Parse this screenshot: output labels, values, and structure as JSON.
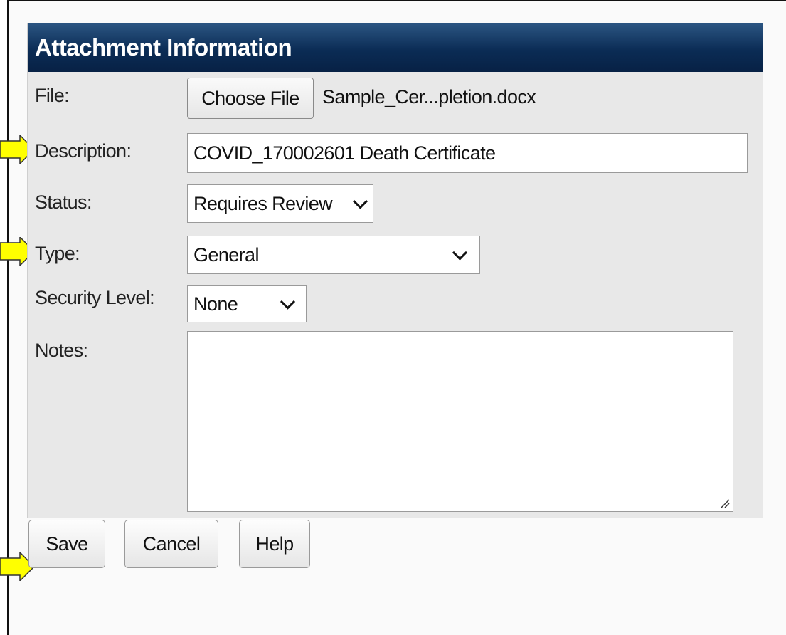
{
  "panel": {
    "title": "Attachment Information"
  },
  "fields": {
    "file_label": "File:",
    "choose_file_label": "Choose File",
    "file_name": "Sample_Cer...pletion.docx",
    "description_label": "Description:",
    "description_value": "COVID_170002601 Death Certificate",
    "status_label": "Status:",
    "status_value": "Requires Review",
    "type_label": "Type:",
    "type_value": "General",
    "security_label": "Security Level:",
    "security_value": "None",
    "notes_label": "Notes:",
    "notes_value": ""
  },
  "buttons": {
    "save": "Save",
    "cancel": "Cancel",
    "help": "Help"
  },
  "colors": {
    "header_bg": "#0b2c55",
    "panel_bg": "#e8e8e8",
    "arrow_fill": "#ffff00"
  },
  "icons": [
    "chevron-down-icon",
    "resize-grip-icon",
    "pointer-arrow-icon"
  ]
}
